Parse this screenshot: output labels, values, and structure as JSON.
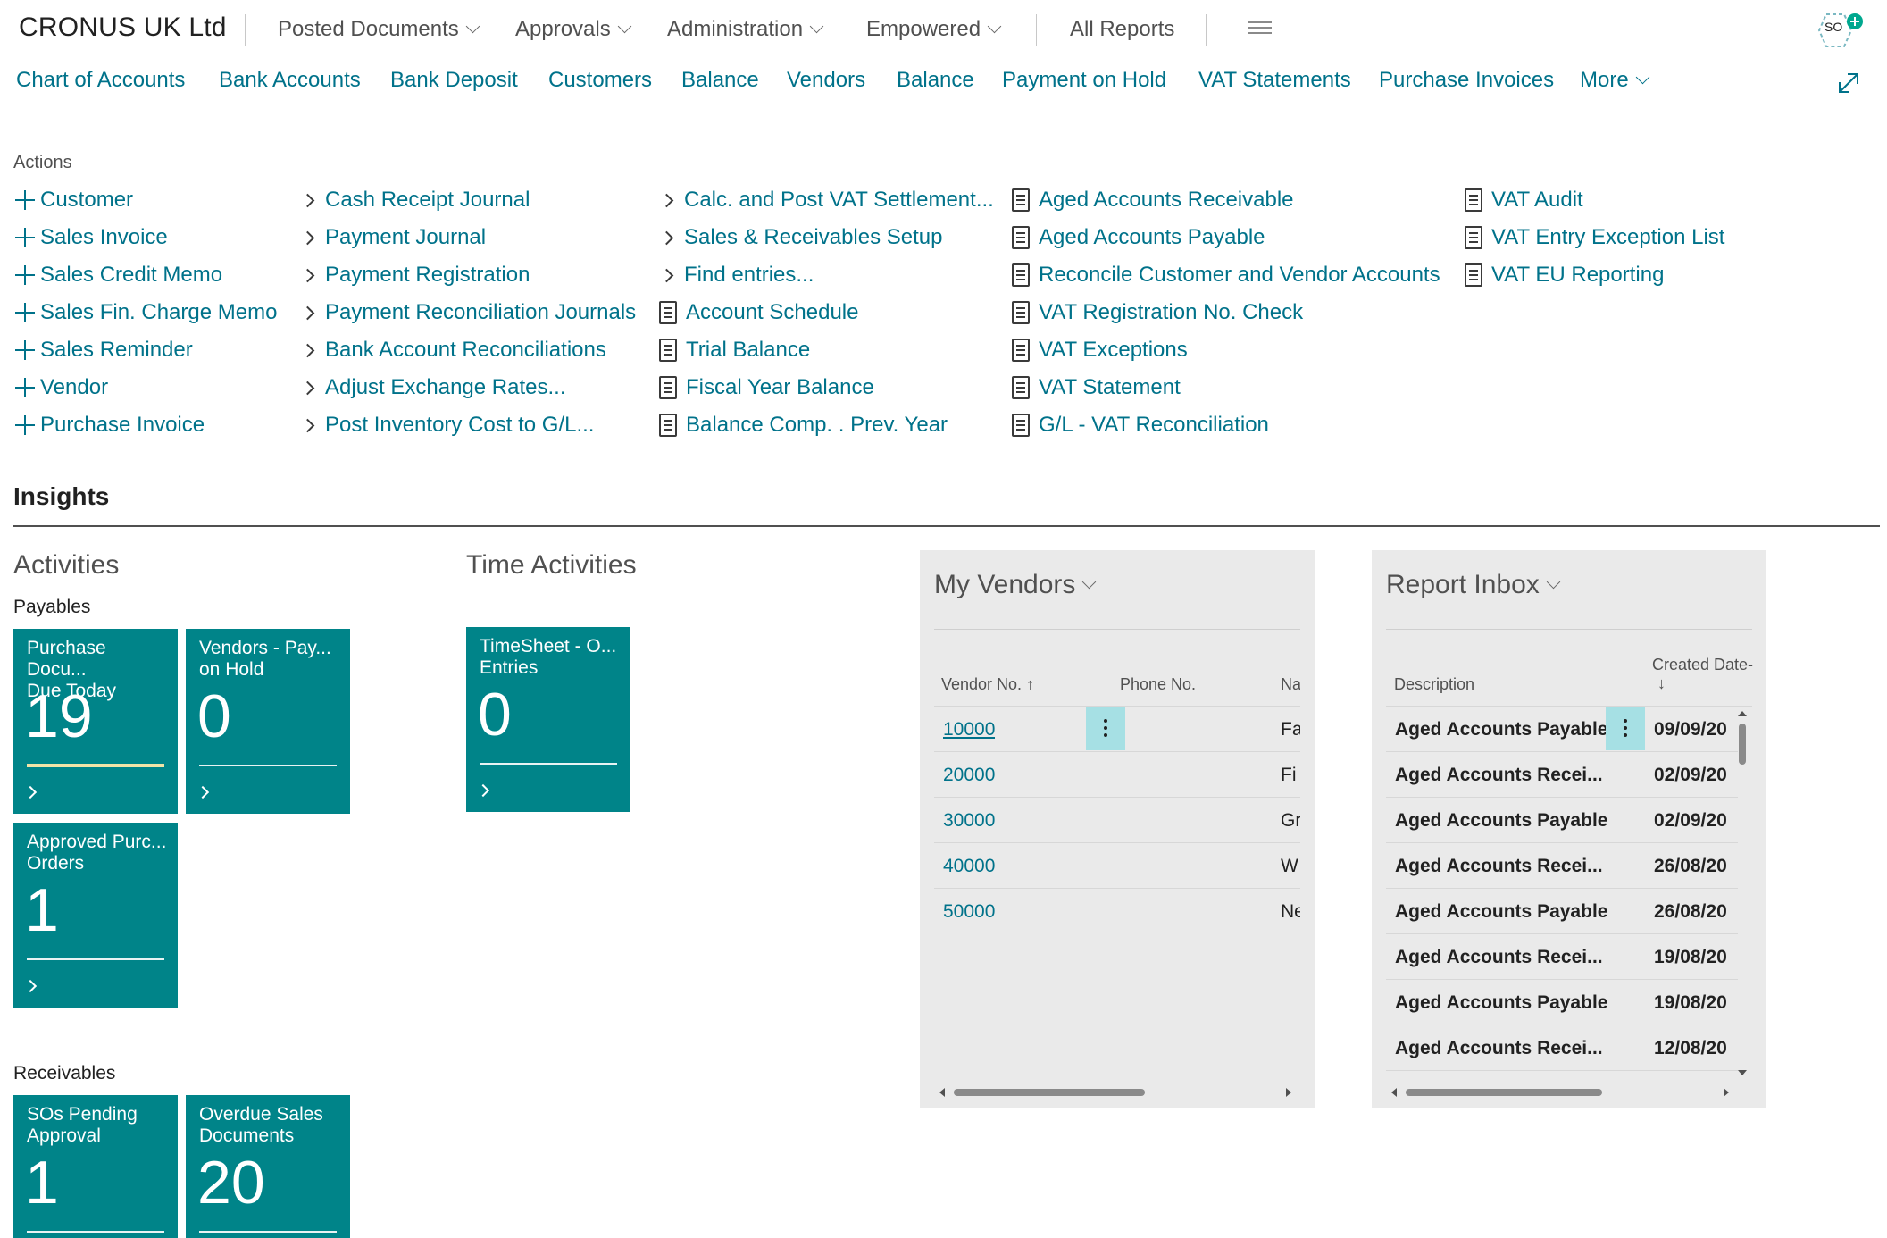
{
  "header": {
    "company": "CRONUS UK Ltd",
    "menus": [
      "Posted Documents",
      "Approvals",
      "Administration",
      "Empowered"
    ],
    "all_reports": "All Reports",
    "avatar_initials": "SO"
  },
  "nav": {
    "links": [
      "Chart of Accounts",
      "Bank Accounts",
      "Bank Deposit",
      "Customers",
      "Balance",
      "Vendors",
      "Balance",
      "Payment on Hold",
      "VAT Statements",
      "Purchase Invoices"
    ],
    "more": "More"
  },
  "actions": {
    "label": "Actions",
    "col1": [
      "Customer",
      "Sales Invoice",
      "Sales Credit Memo",
      "Sales Fin. Charge Memo",
      "Sales Reminder",
      "Vendor",
      "Purchase Invoice"
    ],
    "col2": [
      "Cash Receipt Journal",
      "Payment Journal",
      "Payment Registration",
      "Payment Reconciliation Journals",
      "Bank Account Reconciliations",
      "Adjust Exchange Rates...",
      "Post Inventory Cost to G/L..."
    ],
    "col3_links": [
      "Calc. and Post VAT Settlement...",
      "Sales & Receivables Setup",
      "Find entries..."
    ],
    "col3_reports": [
      "Account Schedule",
      "Trial Balance",
      "Fiscal Year Balance",
      "Balance Comp. . Prev. Year"
    ],
    "col4": [
      "Aged Accounts Receivable",
      "Aged Accounts Payable",
      "Reconcile Customer and Vendor Accounts",
      "VAT Registration No. Check",
      "VAT Exceptions",
      "VAT Statement",
      "G/L - VAT Reconciliation"
    ],
    "col5": [
      "VAT Audit",
      "VAT Entry Exception List",
      "VAT EU Reporting"
    ]
  },
  "insights": {
    "title": "Insights",
    "activities": {
      "title": "Activities",
      "payables_label": "Payables",
      "receivables_label": "Receivables",
      "tiles": [
        {
          "title": "Purchase Docu...\nDue Today",
          "value": "19"
        },
        {
          "title": "Vendors - Pay...\non Hold",
          "value": "0"
        },
        {
          "title": "Approved Purc...\nOrders",
          "value": "1"
        },
        {
          "title": "SOs Pending\nApproval",
          "value": "1"
        },
        {
          "title": "Overdue Sales\nDocuments",
          "value": "20"
        }
      ]
    },
    "time_activities": {
      "title": "Time Activities",
      "tiles": [
        {
          "title": "TimeSheet - O...\nEntries",
          "value": "0"
        }
      ]
    },
    "my_vendors": {
      "title": "My Vendors",
      "columns": [
        "Vendor No.",
        "Phone No.",
        "Na"
      ],
      "sort_indicator": "↑",
      "rows": [
        {
          "no": "10000",
          "phone": "",
          "name": "Fa"
        },
        {
          "no": "20000",
          "phone": "",
          "name": "Fi"
        },
        {
          "no": "30000",
          "phone": "",
          "name": "Gr"
        },
        {
          "no": "40000",
          "phone": "",
          "name": "W"
        },
        {
          "no": "50000",
          "phone": "",
          "name": "Ne"
        }
      ]
    },
    "report_inbox": {
      "title": "Report Inbox",
      "columns": [
        "Description",
        "Created Date-"
      ],
      "sort_indicator": "↓",
      "rows": [
        {
          "desc": "Aged Accounts Payable",
          "date": "09/09/20"
        },
        {
          "desc": "Aged Accounts Recei...",
          "date": "02/09/20"
        },
        {
          "desc": "Aged Accounts Payable",
          "date": "02/09/20"
        },
        {
          "desc": "Aged Accounts Recei...",
          "date": "26/08/20"
        },
        {
          "desc": "Aged Accounts Payable",
          "date": "26/08/20"
        },
        {
          "desc": "Aged Accounts Recei...",
          "date": "19/08/20"
        },
        {
          "desc": "Aged Accounts Payable",
          "date": "19/08/20"
        },
        {
          "desc": "Aged Accounts Recei...",
          "date": "12/08/20"
        }
      ]
    }
  }
}
